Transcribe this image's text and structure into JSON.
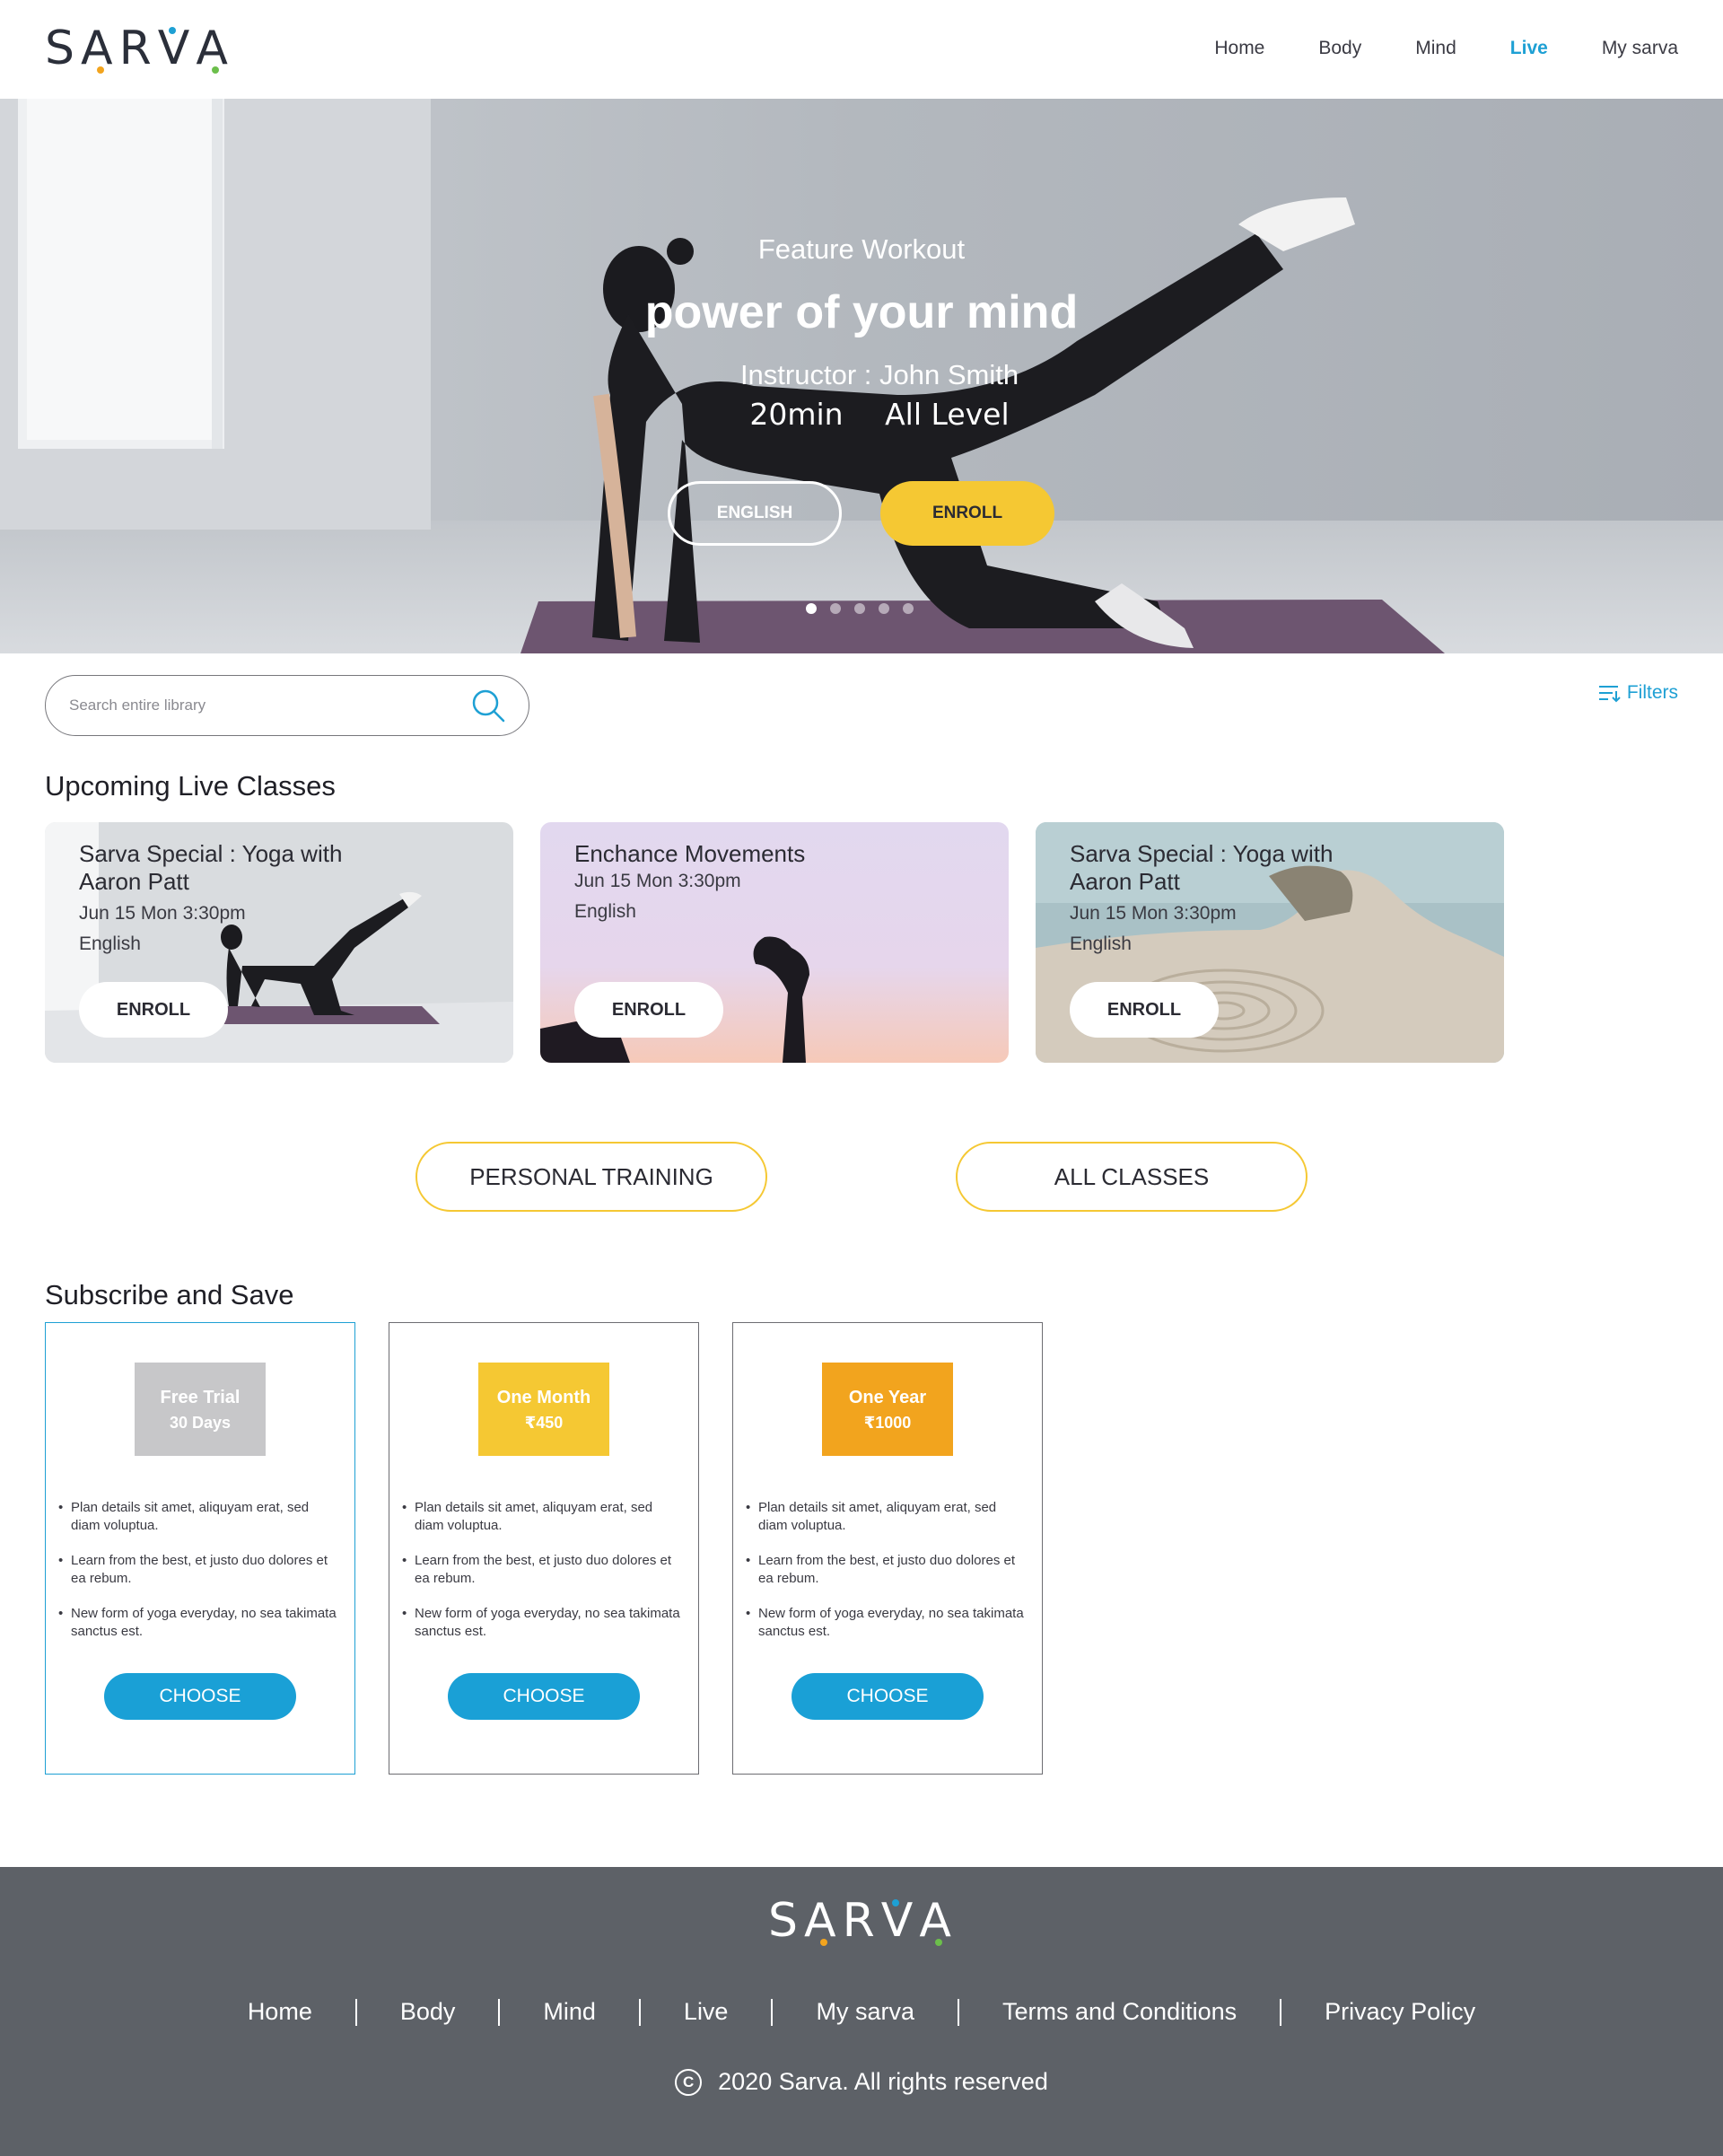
{
  "header": {
    "logo": "SARVA",
    "nav": [
      {
        "label": "Home",
        "active": false
      },
      {
        "label": "Body",
        "active": false
      },
      {
        "label": "Mind",
        "active": false
      },
      {
        "label": "Live",
        "active": true
      },
      {
        "label": "My sarva",
        "active": false
      }
    ]
  },
  "hero": {
    "eyebrow": "Feature Workout",
    "title": "power of your mind",
    "instructor": "Instructor : John Smith",
    "duration": "20min",
    "level": "All Level",
    "language_button": "ENGLISH",
    "enroll_button": "ENROLL",
    "slides_total": 5,
    "slide_active": 1
  },
  "search": {
    "placeholder": "Search entire library",
    "filters_label": "Filters"
  },
  "upcoming": {
    "title": "Upcoming Live Classes",
    "classes": [
      {
        "title": "Sarva Special : Yoga with Aaron Patt",
        "datetime": "Jun 15 Mon 3:30pm",
        "language": "English",
        "button": "ENROLL"
      },
      {
        "title": "Enchance Movements",
        "datetime": "Jun 15 Mon 3:30pm",
        "language": "English",
        "button": "ENROLL"
      },
      {
        "title": "Sarva Special : Yoga with Aaron Patt",
        "datetime": "Jun 15 Mon 3:30pm",
        "language": "English",
        "button": "ENROLL"
      }
    ],
    "personal_training": "PERSONAL TRAINING",
    "all_classes": "ALL CLASSES"
  },
  "subscribe": {
    "title": "Subscribe and Save",
    "plans": [
      {
        "name": "Free Trial",
        "price": "30 Days",
        "color": "#c7c7c9",
        "features": [
          "Plan details sit amet, aliquyam erat, sed diam voluptua.",
          "Learn from the best, et justo duo dolores et ea rebum.",
          "New form of yoga everyday, no sea takimata sanctus est."
        ],
        "button": "CHOOSE",
        "selected": true
      },
      {
        "name": "One Month",
        "price": "₹450",
        "color": "#f5c833",
        "features": [
          "Plan details sit amet, aliquyam erat, sed diam voluptua.",
          "Learn from the best, et justo duo dolores et ea rebum.",
          "New form of yoga everyday, no sea takimata sanctus est."
        ],
        "button": "CHOOSE",
        "selected": false
      },
      {
        "name": "One Year",
        "price": "₹1000",
        "color": "#f2a41e",
        "features": [
          "Plan details sit amet, aliquyam erat, sed diam voluptua.",
          "Learn from the best, et justo duo dolores et ea rebum.",
          "New form of yoga everyday, no sea takimata sanctus est."
        ],
        "button": "CHOOSE",
        "selected": false
      }
    ]
  },
  "footer": {
    "logo": "SARVA",
    "links": [
      "Home",
      "Body",
      "Mind",
      "Live",
      "My sarva",
      "Terms and Conditions",
      "Privacy Policy"
    ],
    "copyright": "2020 Sarva. All rights reserved"
  },
  "colors": {
    "accent": "#1ea0d4",
    "yellow": "#f5c833",
    "orange": "#f2a41e",
    "footer_bg": "#5d6167"
  }
}
